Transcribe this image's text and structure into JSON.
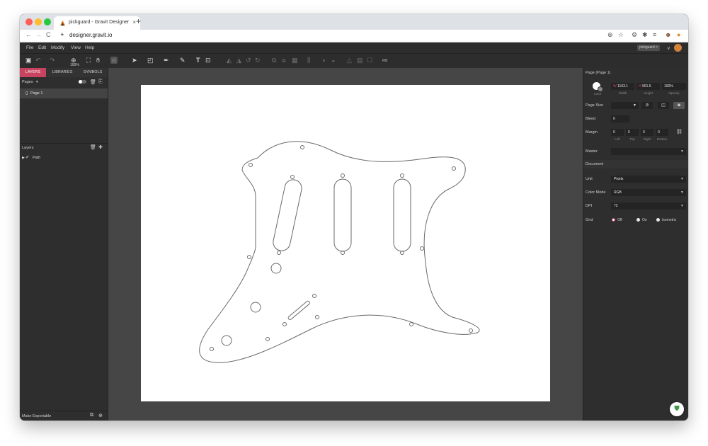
{
  "browser": {
    "tab_title": "pickguard - Gravit Designer",
    "tab_close": "×",
    "new_tab": "+",
    "url": "designer.gravit.io",
    "nav": {
      "back": "←",
      "forward": "→",
      "reload": "C"
    },
    "ext_icons": [
      "⊕",
      "☆",
      "⚙",
      "✱",
      "≡",
      "☻",
      "●"
    ]
  },
  "menubar": {
    "items": [
      "File",
      "Edit",
      "Modify",
      "View",
      "Help"
    ],
    "doc_tag": "pickguard ×",
    "user_caret": "∨"
  },
  "toolbar": {
    "zoom_label": "100%"
  },
  "left_panel": {
    "tabs": [
      "LAYERS",
      "LIBRARIES",
      "SYMBOLS"
    ],
    "pages_label": "Pages",
    "pages_caret": "▼",
    "page_name": "Page 1",
    "layers_label": "Layers",
    "layer_name": "Path",
    "make_exportable": "Make Exportable"
  },
  "right_panel": {
    "header": "Page (Page 1)",
    "color_caption": "Color",
    "width_prefix": "W",
    "width": "1163.1",
    "width_caption": "Width",
    "height_prefix": "H",
    "height": "901.5",
    "height_caption": "Height",
    "opacity": "100%",
    "opacity_caption": "Opacity",
    "page_size_label": "Page Size",
    "bleed_label": "Bleed",
    "bleed_value": "0",
    "margin_label": "Margin",
    "margin_values": [
      "0",
      "0",
      "0",
      "0"
    ],
    "margin_captions": [
      "Left",
      "Top",
      "Right",
      "Bottom"
    ],
    "master_label": "Master",
    "document_header": "Document",
    "unit_label": "Unit",
    "unit_value": "Pixels",
    "color_mode_label": "Color Mode",
    "color_mode_value": "RGB",
    "dpi_label": "DPI",
    "dpi_value": "72",
    "grid_label": "Grid",
    "grid_options": [
      "Off",
      "On",
      "Isometric"
    ],
    "grid_selected": "Off"
  },
  "colors": {
    "accent": "#c8435f",
    "panel_bg": "#2e2e2e",
    "canvas_bg": "#464646",
    "artboard": "#ffffff",
    "outline": "#6a6a6a"
  }
}
